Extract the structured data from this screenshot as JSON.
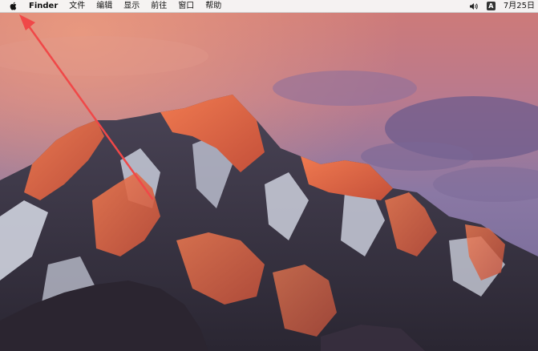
{
  "menubar": {
    "apple_icon": "apple-logo-icon",
    "app_name": "Finder",
    "menus": [
      "文件",
      "编辑",
      "显示",
      "前往",
      "窗口",
      "帮助"
    ],
    "volume_icon": "volume-icon",
    "input_source": "A",
    "clock": "7月25日"
  },
  "annotation": {
    "arrow_color": "#f04848"
  },
  "colors": {
    "menubar_bg": "#f6f6f6",
    "sky_top": "#c8727a",
    "sky_bottom": "#7c6a96",
    "mountain_lit": "#e0704a"
  }
}
